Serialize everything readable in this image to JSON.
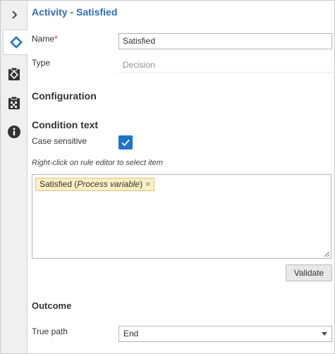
{
  "header": {
    "title": "Activity  - Satisfied"
  },
  "rail": {
    "items": [
      {
        "icon": "chevron-right-icon"
      },
      {
        "icon": "diamond-decision-icon",
        "active": true
      },
      {
        "icon": "clipboard-icon"
      },
      {
        "icon": "checklist-icon"
      },
      {
        "icon": "info-icon"
      }
    ]
  },
  "form": {
    "name_label": "Name",
    "required_mark": "*",
    "name_value": "Satisfied",
    "type_label": "Type",
    "type_value": "Decision"
  },
  "configuration": {
    "heading": "Configuration"
  },
  "condition": {
    "heading": "Condition text",
    "case_sensitive_label": "Case sensitive",
    "case_sensitive_checked": true,
    "hint": "Right-click on rule editor to select item",
    "chip_name": "Satisfied",
    "chip_open": " (",
    "chip_kind": "Process variable",
    "chip_close": ")",
    "chip_remove": "×",
    "validate_label": "Validate"
  },
  "outcome": {
    "heading": "Outcome",
    "true_path_label": "True path",
    "true_path_value": "End"
  },
  "colors": {
    "accent": "#1e74c9",
    "title": "#2e6db4",
    "chip_bg": "#fcefc2"
  }
}
